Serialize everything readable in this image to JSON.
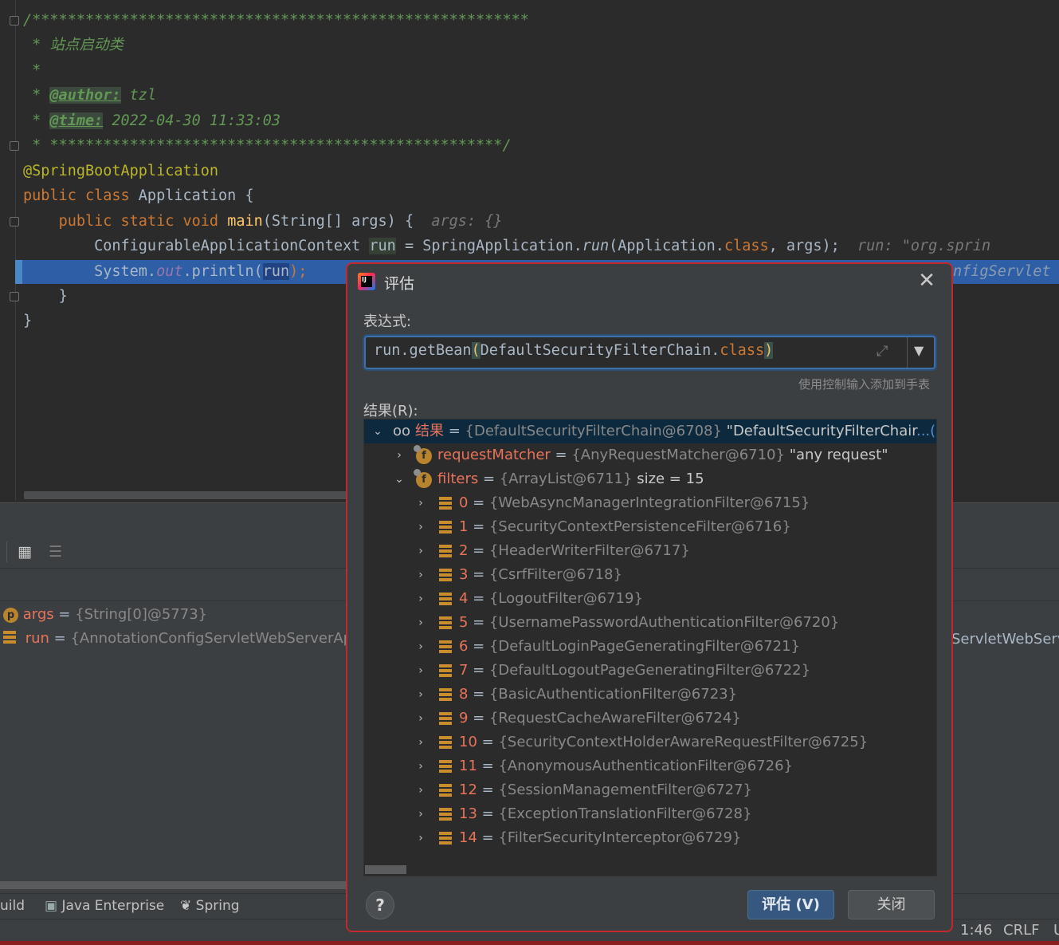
{
  "editor": {
    "doc": {
      "line1": "/********************************************************",
      "line2_star": " * ",
      "line2_text": "站点启动类",
      "line3": " *",
      "author_tag": "@author:",
      "author_value": " tzl",
      "time_tag": "@time:",
      "time_value": " 2022-04-30 11:33:03",
      "line6": " * ***************************************************/"
    },
    "annotation": "@SpringBootApplication",
    "class_kw": "public class",
    "class_name": " Application {",
    "main_kw": "public static void",
    "main_fn": "main",
    "main_params": "(String[] args) {",
    "main_hint": "args: {}",
    "line10_type": "ConfigurableApplicationContext ",
    "line10_var": "run",
    "line10_mid": " = SpringApplication.",
    "line10_fn": "run",
    "line10_open": "(Application.",
    "line10_kw": "class",
    "line10_end": ", args);",
    "line10_hint": "run: \"org.sprin",
    "line11_a": "System.",
    "line11_field": "out",
    "line11_b": ".println(",
    "line11_var": "run",
    "line11_c": ");",
    "line11_hint": "nfigServlet",
    "close1": "}",
    "close2": "}"
  },
  "debug": {
    "variables": [
      {
        "badge": "p",
        "name": "args",
        "value": "{String[0]@5773}"
      },
      {
        "badge": "stripe",
        "name": "run",
        "value": "{AnnotationConfigServletWebServerAppl"
      }
    ],
    "right_peek": "ServletWebServ"
  },
  "bottom_tabs": {
    "tab1": "uild",
    "tab2": "Java Enterprise",
    "tab3": "Spring"
  },
  "status_bar": {
    "position": "1:46",
    "line_ending": "CRLF",
    "encoding_peek": "U"
  },
  "dialog": {
    "title": "评估",
    "expression_label": "表达式:",
    "expression_a": "run.getBean",
    "expression_paren_open": "(",
    "expression_b": "DefaultSecurityFilterChain.",
    "expression_kw": "class",
    "expression_paren_close": ")",
    "add_to_watches": "使用控制输入添加到手表",
    "result_label": "结果(R):",
    "result_root": {
      "name": "结果",
      "type": "{DefaultSecurityFilterChain@6708}",
      "value": "\"DefaultSecurityFilterChair",
      "show_link": "...(显示)"
    },
    "request_matcher": {
      "name": "requestMatcher",
      "type": "{AnyRequestMatcher@6710}",
      "value": "\"any request\""
    },
    "filters_node": {
      "name": "filters",
      "type": "{ArrayList@6711}",
      "size_text": "size = 15"
    },
    "filters": [
      {
        "index": "0",
        "type": "{WebAsyncManagerIntegrationFilter@6715}"
      },
      {
        "index": "1",
        "type": "{SecurityContextPersistenceFilter@6716}"
      },
      {
        "index": "2",
        "type": "{HeaderWriterFilter@6717}"
      },
      {
        "index": "3",
        "type": "{CsrfFilter@6718}"
      },
      {
        "index": "4",
        "type": "{LogoutFilter@6719}"
      },
      {
        "index": "5",
        "type": "{UsernamePasswordAuthenticationFilter@6720}"
      },
      {
        "index": "6",
        "type": "{DefaultLoginPageGeneratingFilter@6721}"
      },
      {
        "index": "7",
        "type": "{DefaultLogoutPageGeneratingFilter@6722}"
      },
      {
        "index": "8",
        "type": "{BasicAuthenticationFilter@6723}"
      },
      {
        "index": "9",
        "type": "{RequestCacheAwareFilter@6724}"
      },
      {
        "index": "10",
        "type": "{SecurityContextHolderAwareRequestFilter@6725}"
      },
      {
        "index": "11",
        "type": "{AnonymousAuthenticationFilter@6726}"
      },
      {
        "index": "12",
        "type": "{SessionManagementFilter@6727}"
      },
      {
        "index": "13",
        "type": "{ExceptionTranslationFilter@6728}"
      },
      {
        "index": "14",
        "type": "{FilterSecurityInterceptor@6729}"
      }
    ],
    "help_label": "?",
    "evaluate_button": "评估 (V)",
    "close_button": "关闭"
  },
  "colors": {
    "editor_bg": "#2b2b2b",
    "panel_bg": "#3c3f41",
    "dialog_border": "#c2282d",
    "keyword": "#cc7832",
    "method": "#ffc66d",
    "comment": "#629755",
    "annotation": "#bbb529",
    "field_name": "#e8735a",
    "primary_button": "#365880"
  }
}
